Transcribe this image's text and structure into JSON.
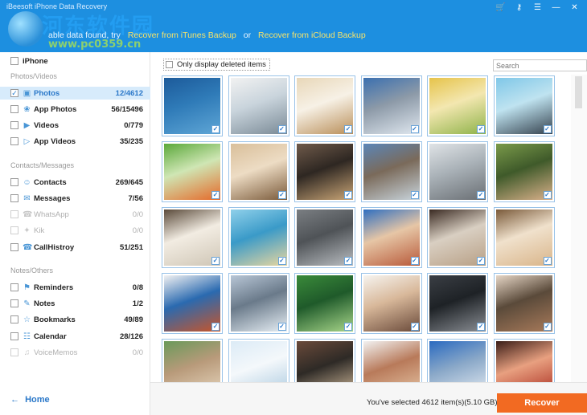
{
  "window": {
    "title": "iBeesoft iPhone Data Recovery",
    "controls": [
      "shop-icon",
      "key-icon",
      "menu-icon",
      "minimize-icon",
      "close-icon"
    ]
  },
  "watermark": {
    "main": "河东软件园",
    "sub": "www.pc0359.cn"
  },
  "header": {
    "info_prefix": "able data found, try",
    "itunes_link": "Recover from iTunes Backup",
    "or_text": "or",
    "icloud_link": "Recover from iCloud Backup"
  },
  "sidebar": {
    "device": {
      "label": "iPhone",
      "checked": false
    },
    "sections": [
      {
        "title": "Photos/Videos"
      },
      {
        "title": "Contacts/Messages"
      },
      {
        "title": "Notes/Others"
      }
    ],
    "items": [
      {
        "label": "Photos",
        "count": "12/4612",
        "checked": true,
        "selected": true,
        "dim": false,
        "icon": "photo-icon"
      },
      {
        "label": "App Photos",
        "count": "56/15496",
        "checked": false,
        "selected": false,
        "dim": false,
        "icon": "app-photo-icon"
      },
      {
        "label": "Videos",
        "count": "0/779",
        "checked": false,
        "selected": false,
        "dim": false,
        "icon": "video-icon"
      },
      {
        "label": "App Videos",
        "count": "35/235",
        "checked": false,
        "selected": false,
        "dim": false,
        "icon": "app-video-icon"
      },
      {
        "label": "Contacts",
        "count": "269/645",
        "checked": false,
        "selected": false,
        "dim": false,
        "icon": "contacts-icon"
      },
      {
        "label": "Messages",
        "count": "7/56",
        "checked": false,
        "selected": false,
        "dim": false,
        "icon": "messages-icon"
      },
      {
        "label": "WhatsApp",
        "count": "0/0",
        "checked": false,
        "selected": false,
        "dim": true,
        "icon": "whatsapp-icon"
      },
      {
        "label": "Kik",
        "count": "0/0",
        "checked": false,
        "selected": false,
        "dim": true,
        "icon": "kik-icon"
      },
      {
        "label": "CallHistroy",
        "count": "51/251",
        "checked": false,
        "selected": false,
        "dim": false,
        "icon": "call-history-icon"
      },
      {
        "label": "Reminders",
        "count": "0/8",
        "checked": false,
        "selected": false,
        "dim": false,
        "icon": "reminders-icon"
      },
      {
        "label": "Notes",
        "count": "1/2",
        "checked": false,
        "selected": false,
        "dim": false,
        "icon": "notes-icon"
      },
      {
        "label": "Bookmarks",
        "count": "49/89",
        "checked": false,
        "selected": false,
        "dim": false,
        "icon": "bookmarks-icon"
      },
      {
        "label": "Calendar",
        "count": "28/126",
        "checked": false,
        "selected": false,
        "dim": false,
        "icon": "calendar-icon"
      },
      {
        "label": "VoiceMemos",
        "count": "0/0",
        "checked": false,
        "selected": false,
        "dim": true,
        "icon": "voice-memos-icon"
      }
    ],
    "home_label": "Home"
  },
  "toolbar": {
    "only_deleted_label": "Only display deleted items",
    "only_deleted_checked": false,
    "search_placeholder": "Search"
  },
  "photos": [
    {
      "checked": true,
      "colors": [
        "#1c5a9a",
        "#5fa6d6",
        "#2f7bb8"
      ]
    },
    {
      "checked": true,
      "colors": [
        "#f2f2f2",
        "#7a8a96",
        "#c9d4dc"
      ]
    },
    {
      "checked": true,
      "colors": [
        "#e8d7b8",
        "#b98f5a",
        "#f7f1e6"
      ]
    },
    {
      "checked": true,
      "colors": [
        "#3a6fb0",
        "#dfe7ef",
        "#8d9aa8"
      ]
    },
    {
      "checked": true,
      "colors": [
        "#e6c34a",
        "#8fb34a",
        "#f3e7b0"
      ]
    },
    {
      "checked": true,
      "colors": [
        "#7fc7e8",
        "#36434f",
        "#bfe3f0"
      ]
    },
    {
      "checked": true,
      "colors": [
        "#5aa83a",
        "#e56a2a",
        "#cfe6b4"
      ]
    },
    {
      "checked": true,
      "colors": [
        "#d9bf9a",
        "#7a5a3a",
        "#eddcc4"
      ]
    },
    {
      "checked": true,
      "colors": [
        "#6f5a4a",
        "#c9a576",
        "#2e2722"
      ]
    },
    {
      "checked": true,
      "colors": [
        "#5b86b8",
        "#c8d4dc",
        "#7a6a5a"
      ]
    },
    {
      "checked": true,
      "colors": [
        "#dfe3e6",
        "#6a6f74",
        "#aab2b8"
      ]
    },
    {
      "checked": true,
      "colors": [
        "#7a9a4a",
        "#d9b08a",
        "#3f5a2a"
      ]
    },
    {
      "checked": true,
      "colors": [
        "#5a4a3a",
        "#cfc6b6",
        "#f2ece2"
      ]
    },
    {
      "checked": true,
      "colors": [
        "#8fd0ea",
        "#e8d6a0",
        "#3a9ac8"
      ]
    },
    {
      "checked": true,
      "colors": [
        "#7a7e82",
        "#b9bdc1",
        "#4f5357"
      ]
    },
    {
      "checked": true,
      "colors": [
        "#2f6fc0",
        "#b85a3a",
        "#e6c6a6"
      ]
    },
    {
      "checked": true,
      "colors": [
        "#3a2a22",
        "#b8a086",
        "#d9cfc2"
      ]
    },
    {
      "checked": true,
      "colors": [
        "#7a5a3a",
        "#d9b58a",
        "#f0e1cc"
      ]
    },
    {
      "checked": true,
      "colors": [
        "#f2f2f2",
        "#c8552a",
        "#2a6ab0"
      ]
    },
    {
      "checked": true,
      "colors": [
        "#b8c6d6",
        "#e6eef4",
        "#6a7a8a"
      ]
    },
    {
      "checked": true,
      "colors": [
        "#3a8a3a",
        "#a8d68a",
        "#1f5a2a"
      ]
    },
    {
      "checked": true,
      "colors": [
        "#f6f4f0",
        "#6a4a3a",
        "#d8b89a"
      ]
    },
    {
      "checked": true,
      "colors": [
        "#3a3e44",
        "#8a8e94",
        "#1e2226"
      ]
    },
    {
      "checked": true,
      "colors": [
        "#e6d6c6",
        "#a87a5a",
        "#5a4a3a"
      ]
    },
    {
      "checked": true,
      "colors": [
        "#6a9a5a",
        "#e8d8c0",
        "#b89a7a"
      ]
    },
    {
      "checked": true,
      "colors": [
        "#dcebf6",
        "#a8c8de",
        "#f4f8fb"
      ]
    },
    {
      "checked": true,
      "colors": [
        "#6a4a3a",
        "#d8c0a0",
        "#2e2a26"
      ]
    },
    {
      "checked": true,
      "colors": [
        "#f2f2f2",
        "#e8c8a8",
        "#b87a5a"
      ]
    },
    {
      "checked": true,
      "colors": [
        "#2a6ac0",
        "#e8eef4",
        "#8aa8c8"
      ]
    },
    {
      "checked": true,
      "colors": [
        "#3a1e18",
        "#a82a1e",
        "#e8a080"
      ]
    }
  ],
  "bottom": {
    "selected_text": "You've selected 4612 item(s)(5.10 GB)",
    "recover_label": "Recover"
  }
}
